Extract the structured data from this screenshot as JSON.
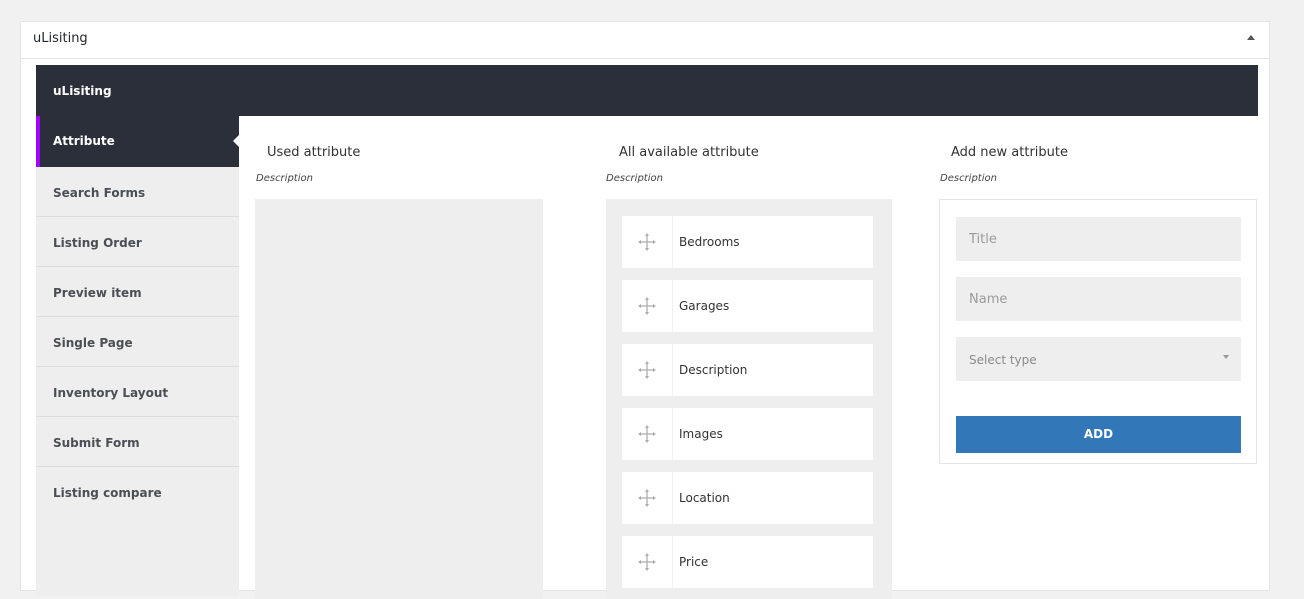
{
  "metabox": {
    "title": "uLisiting"
  },
  "app": {
    "title": "uLisiting"
  },
  "sidebar": {
    "items": [
      {
        "label": "Attribute",
        "active": true
      },
      {
        "label": "Search Forms"
      },
      {
        "label": "Listing Order"
      },
      {
        "label": "Preview item"
      },
      {
        "label": "Single Page"
      },
      {
        "label": "Inventory Layout"
      },
      {
        "label": "Submit Form"
      },
      {
        "label": "Listing compare"
      }
    ]
  },
  "columns": {
    "used": {
      "title": "Used attribute",
      "description": "Description"
    },
    "available": {
      "title": "All available attribute",
      "description": "Description",
      "items": [
        "Bedrooms",
        "Garages",
        "Description",
        "Images",
        "Location",
        "Price"
      ]
    },
    "add_new": {
      "title": "Add new attribute",
      "description": "Description",
      "title_placeholder": "Title",
      "name_placeholder": "Name",
      "select_value": "Select type",
      "button_label": "ADD"
    }
  },
  "colors": {
    "sidebar_active_accent": "#a200ff",
    "dark_header": "#2b2f3a",
    "button": "#3278b9"
  },
  "icons": {
    "collapse": "triangle-up-icon",
    "drag": "move-arrows-icon",
    "select": "chevron-down-icon"
  }
}
